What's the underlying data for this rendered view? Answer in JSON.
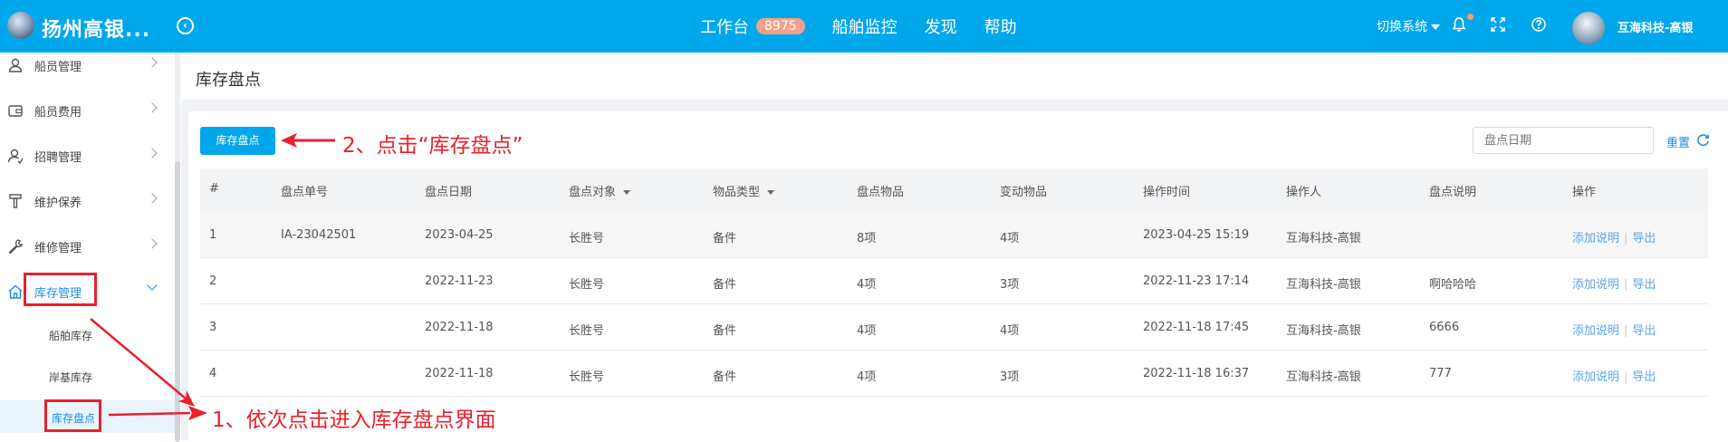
{
  "header": {
    "title": "扬州高银...",
    "nav": [
      {
        "label": "工作台",
        "badge": "8975"
      },
      {
        "label": "船舶监控"
      },
      {
        "label": "发现"
      },
      {
        "label": "帮助"
      }
    ],
    "switch_label": "切换系统",
    "user_name": "互海科技-高银",
    "accent": "#00a7eb"
  },
  "sidebar": {
    "items": [
      {
        "label": "船员管理",
        "icon": "user-icon"
      },
      {
        "label": "船员费用",
        "icon": "wallet-icon"
      },
      {
        "label": "招聘管理",
        "icon": "recruit-icon"
      },
      {
        "label": "维护保养",
        "icon": "hammer-icon"
      },
      {
        "label": "维修管理",
        "icon": "wrench-icon"
      },
      {
        "label": "库存管理",
        "icon": "home-icon",
        "active": true
      }
    ],
    "sub_items": [
      {
        "label": "船舶库存"
      },
      {
        "label": "岸基库存"
      },
      {
        "label": "库存盘点",
        "active": true
      }
    ]
  },
  "page": {
    "title": "库存盘点",
    "primary_button": "库存盘点",
    "date_placeholder": "盘点日期",
    "reset_label": "重置"
  },
  "table": {
    "columns": [
      "#",
      "盘点单号",
      "盘点日期",
      "盘点对象",
      "物品类型",
      "盘点物品",
      "变动物品",
      "操作时间",
      "操作人",
      "盘点说明",
      "操作"
    ],
    "rows": [
      {
        "idx": "1",
        "no": "IA-23042501",
        "date": "2023-04-25",
        "target": "长胜号",
        "type": "备件",
        "items": "8项",
        "changed": "4项",
        "time": "2023-04-25 15:19",
        "operator": "互海科技-高银",
        "note": ""
      },
      {
        "idx": "2",
        "no": "",
        "date": "2022-11-23",
        "target": "长胜号",
        "type": "备件",
        "items": "4项",
        "changed": "3项",
        "time": "2022-11-23 17:14",
        "operator": "互海科技-高银",
        "note": "啊哈哈哈"
      },
      {
        "idx": "3",
        "no": "",
        "date": "2022-11-18",
        "target": "长胜号",
        "type": "备件",
        "items": "4项",
        "changed": "4项",
        "time": "2022-11-18 17:45",
        "operator": "互海科技-高银",
        "note": "6666"
      },
      {
        "idx": "4",
        "no": "",
        "date": "2022-11-18",
        "target": "长胜号",
        "type": "备件",
        "items": "4项",
        "changed": "3项",
        "time": "2022-11-18 16:37",
        "operator": "互海科技-高银",
        "note": "777"
      }
    ],
    "actions": {
      "add_note": "添加说明",
      "export": "导出"
    }
  },
  "annotations": {
    "step2": "2、点击“库存盘点”",
    "step1": "1、依次点击进入库存盘点界面",
    "color": "#e8212d"
  }
}
